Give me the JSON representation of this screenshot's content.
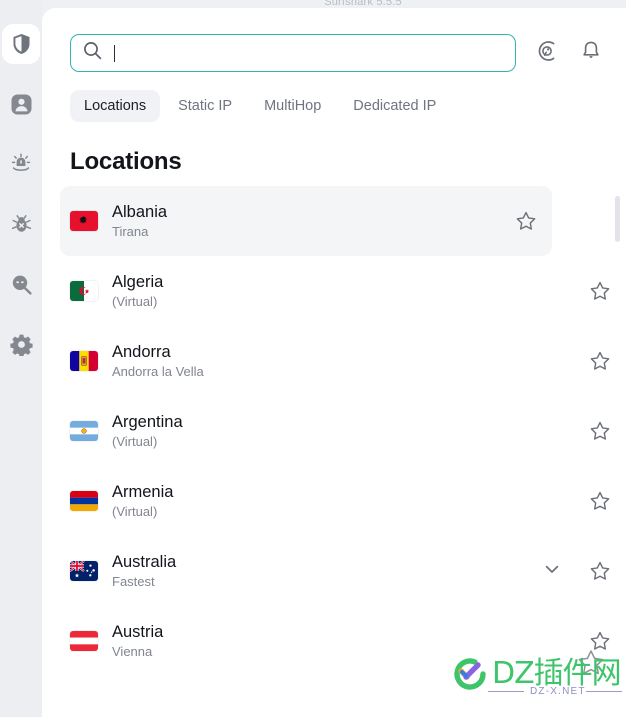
{
  "app": {
    "title_strip": "Surfshark 5.5.5",
    "accent_color": "#2fb5ae",
    "panel_bg": "#ffffff",
    "rail_bg": "#eceef2"
  },
  "rail": {
    "items": [
      {
        "name": "vpn",
        "icon": "shield-icon",
        "active": true
      },
      {
        "name": "account",
        "icon": "person-icon",
        "active": false
      },
      {
        "name": "alert",
        "icon": "alert-icon",
        "active": false
      },
      {
        "name": "antivirus",
        "icon": "bug-icon",
        "active": false
      },
      {
        "name": "alternative-id",
        "icon": "search-mask-icon",
        "active": false
      },
      {
        "name": "settings",
        "icon": "gear-icon",
        "active": false
      }
    ]
  },
  "header": {
    "search": {
      "value": "",
      "placeholder": "",
      "icon": "search-icon"
    },
    "actions": [
      {
        "name": "speed-test",
        "icon": "speedometer-icon"
      },
      {
        "name": "notifications",
        "icon": "bell-icon"
      }
    ]
  },
  "tabs": [
    {
      "label": "Locations",
      "active": true
    },
    {
      "label": "Static IP",
      "active": false
    },
    {
      "label": "MultiHop",
      "active": false
    },
    {
      "label": "Dedicated IP",
      "active": false
    }
  ],
  "main": {
    "section_title": "Locations",
    "locations": [
      {
        "country": "Albania",
        "detail": "Tirana",
        "flag": "al",
        "highlighted": true,
        "expandable": false,
        "favorite": false
      },
      {
        "country": "Algeria",
        "detail": "(Virtual)",
        "flag": "dz",
        "highlighted": false,
        "expandable": false,
        "favorite": false
      },
      {
        "country": "Andorra",
        "detail": "Andorra la Vella",
        "flag": "ad",
        "highlighted": false,
        "expandable": false,
        "favorite": false
      },
      {
        "country": "Argentina",
        "detail": "(Virtual)",
        "flag": "ar",
        "highlighted": false,
        "expandable": false,
        "favorite": false
      },
      {
        "country": "Armenia",
        "detail": "(Virtual)",
        "flag": "am",
        "highlighted": false,
        "expandable": false,
        "favorite": false
      },
      {
        "country": "Australia",
        "detail": "Fastest",
        "flag": "au",
        "highlighted": false,
        "expandable": true,
        "favorite": false
      },
      {
        "country": "Austria",
        "detail": "Vienna",
        "flag": "at",
        "highlighted": false,
        "expandable": false,
        "favorite": false
      }
    ]
  },
  "watermark": {
    "text": "DZ插件网",
    "subtext": "DZ-X.NET"
  }
}
